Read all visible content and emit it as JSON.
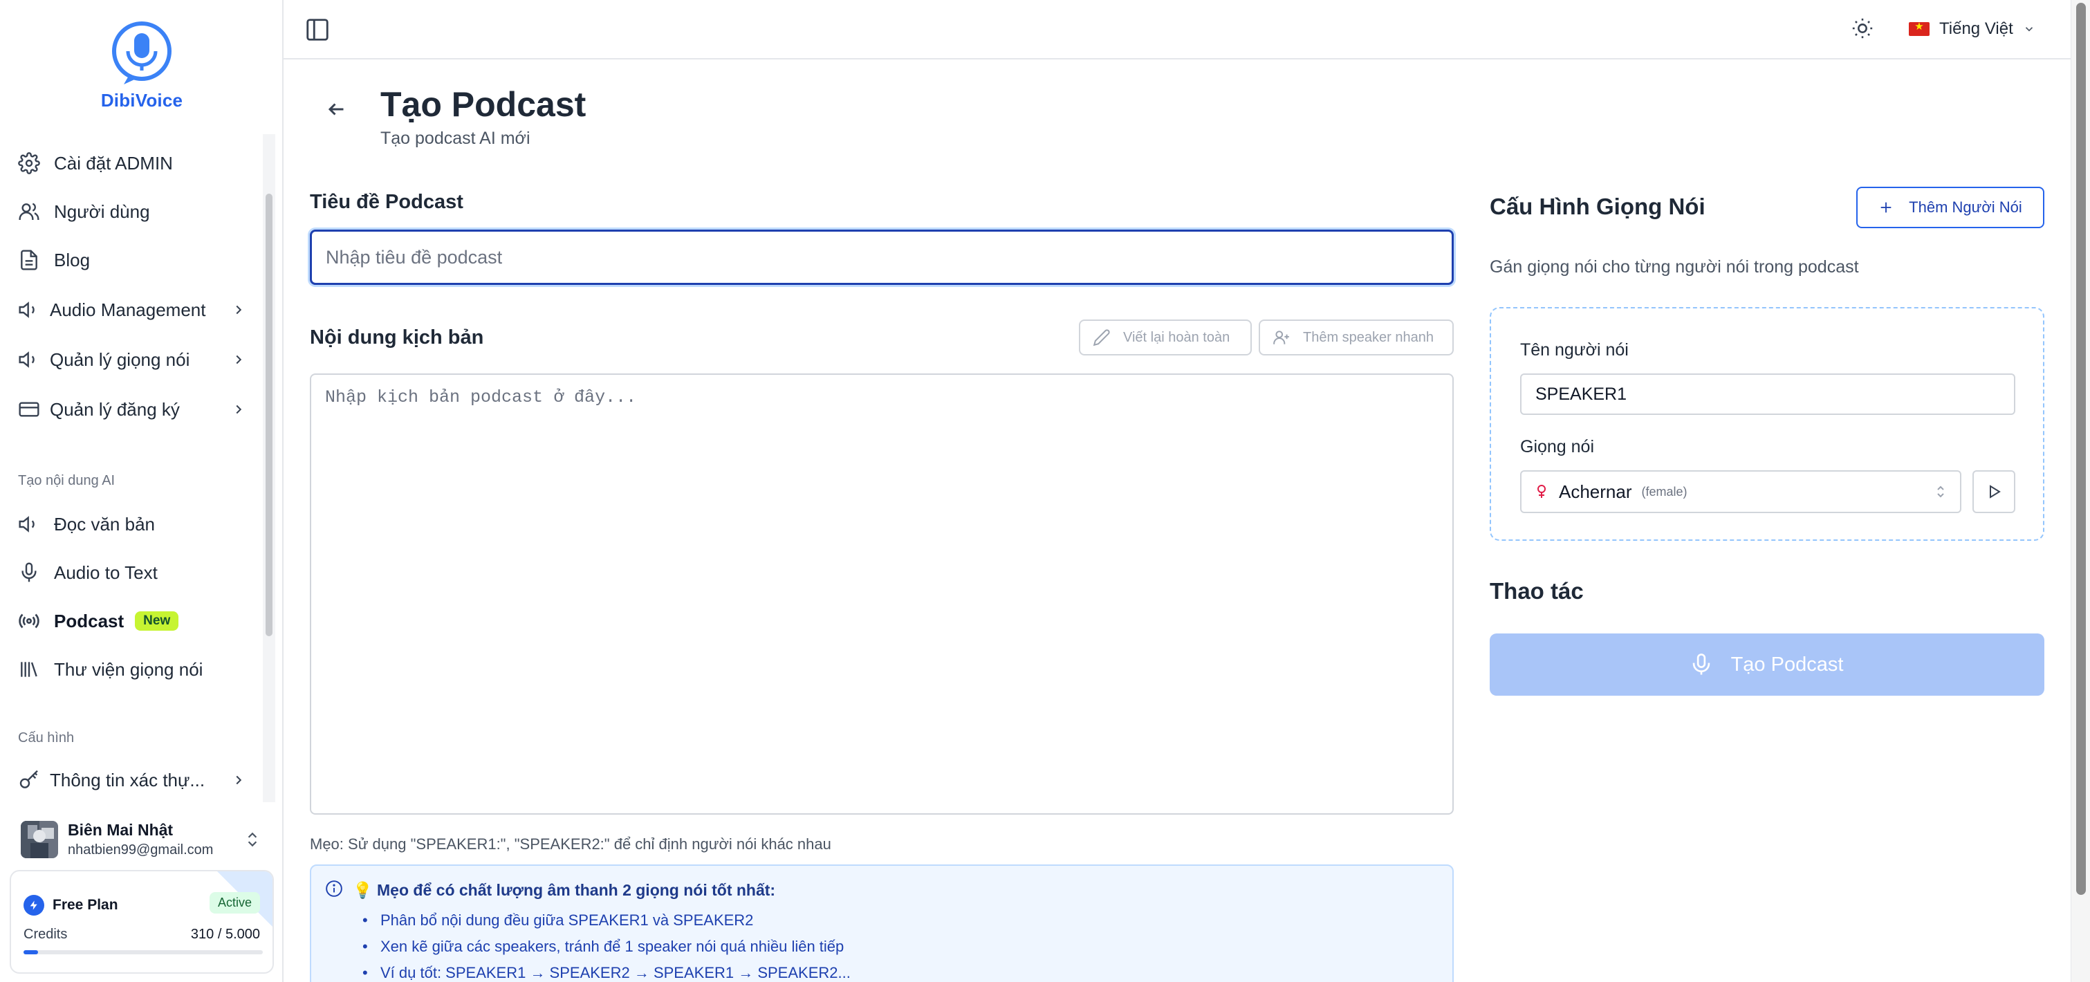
{
  "brand": {
    "name": "DibiVoice",
    "color": "#2563eb"
  },
  "sidebar": {
    "items": [
      {
        "label": "Cài đặt ADMIN",
        "icon": "gear-icon"
      },
      {
        "label": "Người dùng",
        "icon": "users-icon"
      },
      {
        "label": "Blog",
        "icon": "document-icon"
      },
      {
        "label": "Audio Management",
        "icon": "speaker-icon",
        "expandable": true
      },
      {
        "label": "Quản lý giọng nói",
        "icon": "speaker-icon",
        "expandable": true
      },
      {
        "label": "Quản lý đăng ký",
        "icon": "credit-card-icon",
        "expandable": true
      }
    ],
    "section_ai": "Tạo nội dung AI",
    "ai_items": [
      {
        "label": "Đọc văn bản",
        "icon": "speaker-icon"
      },
      {
        "label": "Audio to Text",
        "icon": "mic-icon"
      },
      {
        "label": "Podcast",
        "icon": "broadcast-icon",
        "badge": "New",
        "active": true
      },
      {
        "label": "Thư viện giọng nói",
        "icon": "library-icon"
      }
    ],
    "section_config": "Cấu hình",
    "config_items": [
      {
        "label": "Thông tin xác thự...",
        "icon": "key-icon",
        "expandable": true
      }
    ]
  },
  "user": {
    "name": "Biên Mai Nhật",
    "email": "nhatbien99@gmail.com"
  },
  "plan": {
    "name": "Free Plan",
    "status": "Active",
    "credits_label": "Credits",
    "credits_text": "310 / 5.000",
    "credits_used": 310,
    "credits_total": 5000
  },
  "topbar": {
    "language": "Tiếng Việt"
  },
  "page": {
    "title": "Tạo Podcast",
    "subtitle": "Tạo podcast AI mới"
  },
  "form": {
    "title_label": "Tiêu đề Podcast",
    "title_placeholder": "Nhập tiêu đề podcast",
    "title_value": "",
    "script_label": "Nội dung kịch bản",
    "rewrite_button": "Viết lại hoàn toàn",
    "quick_speaker_button": "Thêm speaker nhanh",
    "script_placeholder": "Nhập kịch bản podcast ở đây...",
    "script_value": "",
    "tip_line": "Mẹo: Sử dụng \"SPEAKER1:\", \"SPEAKER2:\" để chỉ định người nói khác nhau"
  },
  "tips": {
    "heading": "💡 Mẹo để có chất lượng âm thanh 2 giọng nói tốt nhất:",
    "items": [
      "Phân bổ nội dung đều giữa SPEAKER1 và SPEAKER2",
      "Xen kẽ giữa các speakers, tránh để 1 speaker nói quá nhiều liên tiếp",
      "Ví dụ tốt: SPEAKER1 → SPEAKER2 → SPEAKER1 → SPEAKER2..."
    ]
  },
  "voice_config": {
    "title": "Cấu Hình Giọng Nói",
    "add_button": "Thêm Người Nói",
    "description": "Gán giọng nói cho từng người nói trong podcast",
    "speakers": [
      {
        "name_label": "Tên người nói",
        "name_value": "SPEAKER1",
        "voice_label": "Giọng nói",
        "voice": "Achernar",
        "gender": "(female)"
      }
    ]
  },
  "actions": {
    "title": "Thao tác",
    "create_button": "Tạo Podcast",
    "create_color": "#a9c5f8"
  }
}
